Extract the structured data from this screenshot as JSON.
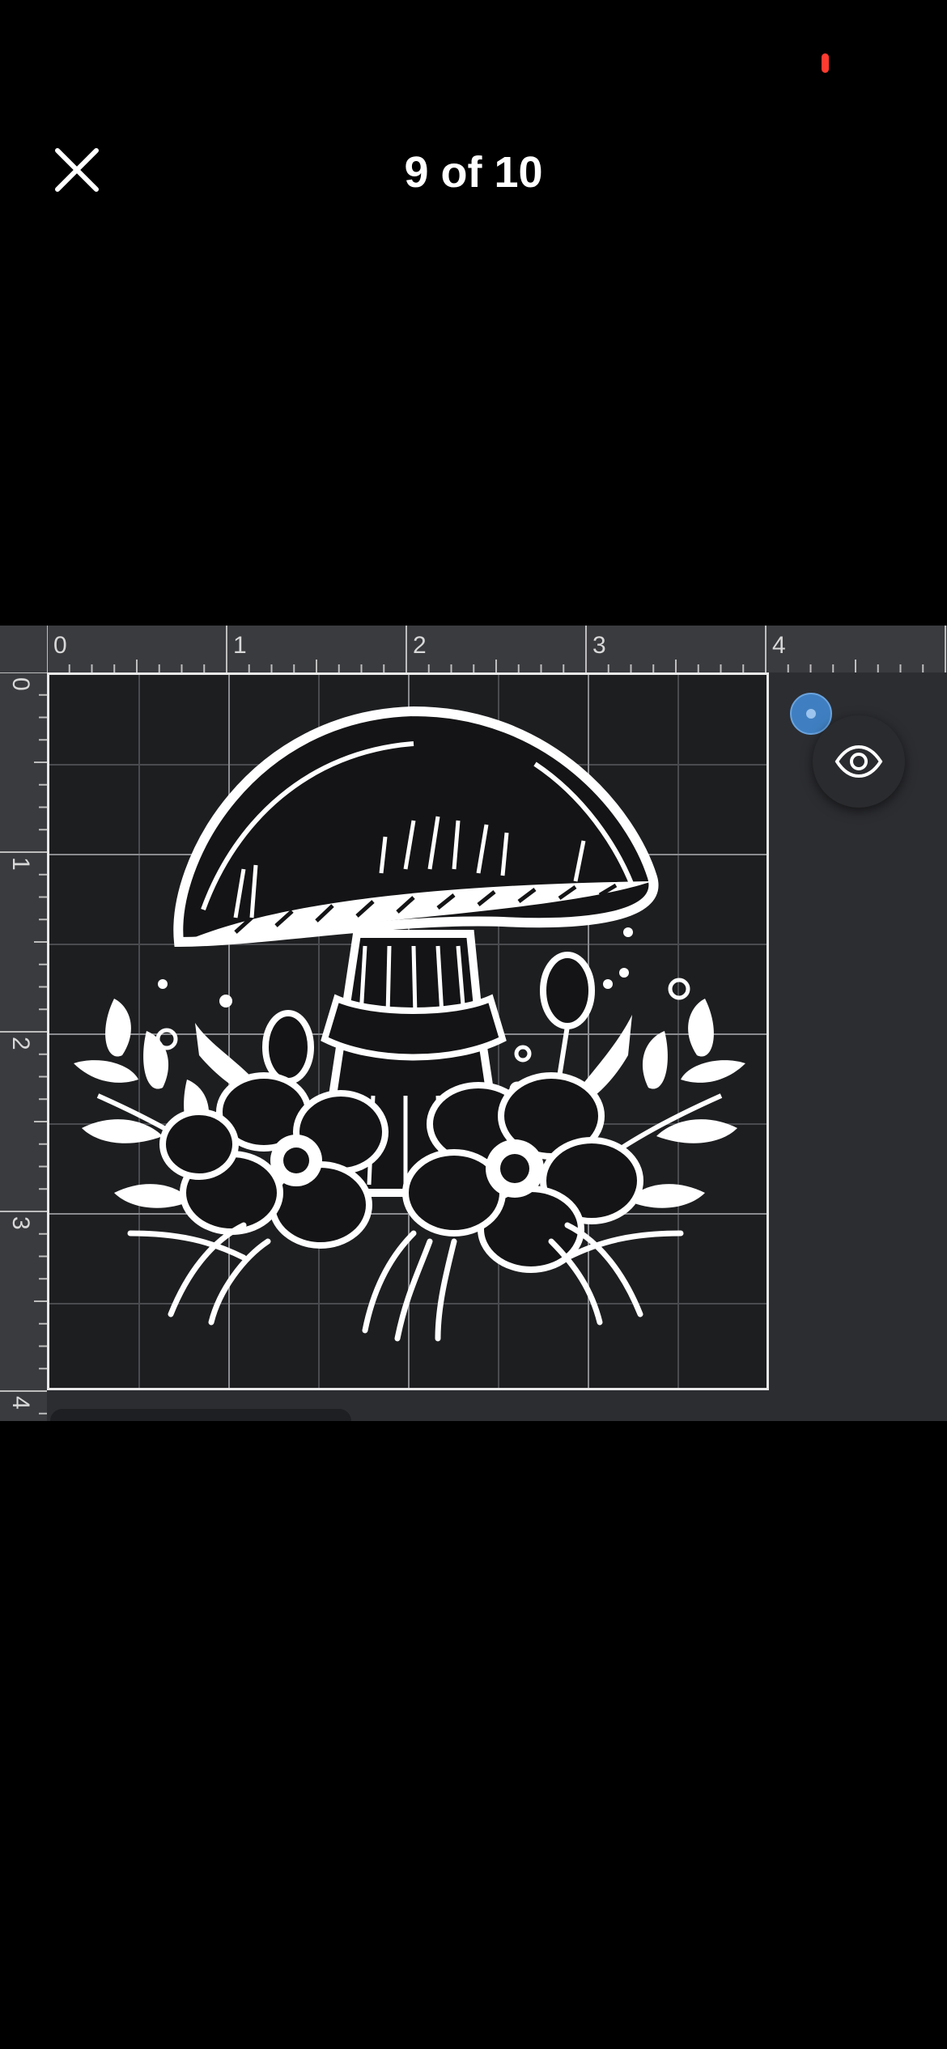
{
  "status_bar": {
    "indicator_color": "#ff3b30"
  },
  "header": {
    "close_icon": "close-icon",
    "title": "9 of 10"
  },
  "canvas_view": {
    "ruler_top_labels": [
      "0",
      "1",
      "2",
      "3",
      "4"
    ],
    "ruler_left_labels": [
      "0",
      "1",
      "2",
      "3",
      "4"
    ],
    "visibility_icon": "eye-icon",
    "handle_color": "#3f7fc1"
  }
}
